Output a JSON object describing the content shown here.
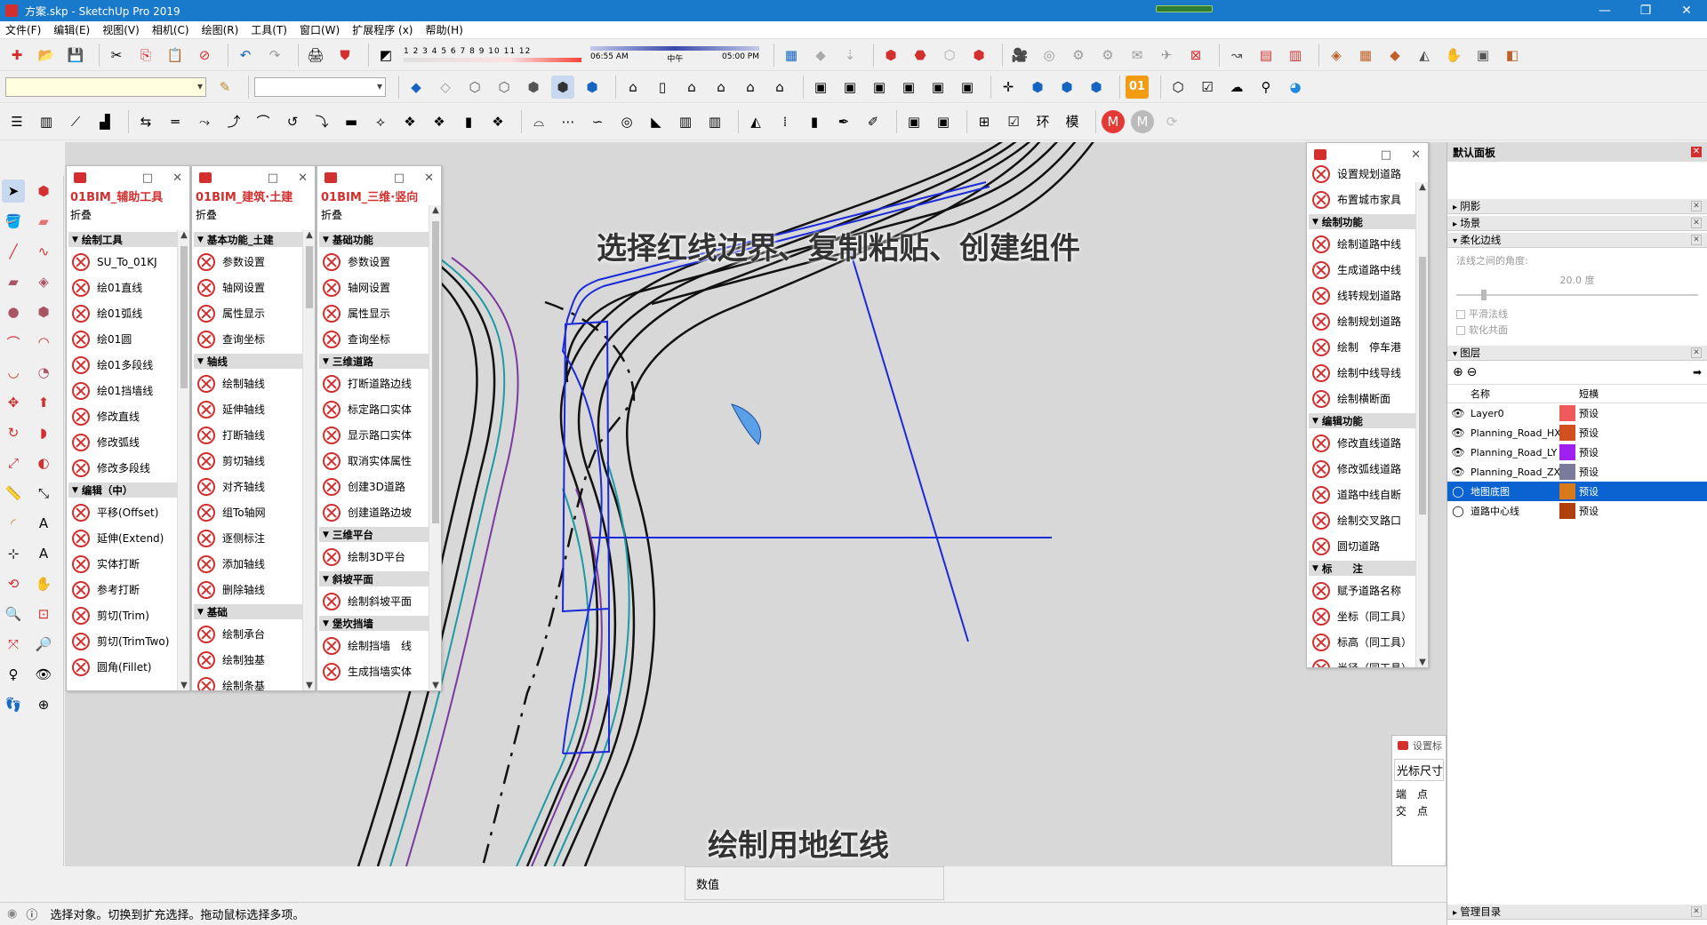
{
  "window": {
    "title": "方案.skp - SketchUp Pro 2019",
    "min": "—",
    "max": "❐",
    "close": "✕"
  },
  "menu": [
    "文件(F)",
    "编辑(E)",
    "视图(V)",
    "相机(C)",
    "绘图(R)",
    "工具(T)",
    "窗口(W)",
    "扩展程序 (x)",
    "帮助(H)"
  ],
  "shadow_scale": {
    "numbers": "1 2 3 4 5 6 7 8 9 10 11 12"
  },
  "time_scale": {
    "start": "06:55 AM",
    "mid": "中午",
    "end": "05:00 PM"
  },
  "toolbar_badge": "01",
  "captions": {
    "top": "选择红线边界、复制粘贴、创建组件",
    "bottom": "绘制用地红线"
  },
  "panel1": {
    "title": "01BIM_辅助工具",
    "fold": "折叠",
    "items": [
      {
        "type": "sec",
        "label": "绘制工具"
      },
      {
        "type": "item",
        "label": "SU_To_01KJ"
      },
      {
        "type": "item",
        "label": "绘01直线"
      },
      {
        "type": "item",
        "label": "绘01弧线"
      },
      {
        "type": "item",
        "label": "绘01圆"
      },
      {
        "type": "item",
        "label": "绘01多段线"
      },
      {
        "type": "item",
        "label": "绘01挡墙线"
      },
      {
        "type": "item",
        "label": "修改直线"
      },
      {
        "type": "item",
        "label": "修改弧线"
      },
      {
        "type": "item",
        "label": "修改多段线"
      },
      {
        "type": "sec",
        "label": "编辑（中）"
      },
      {
        "type": "item",
        "label": "平移(Offset)"
      },
      {
        "type": "item",
        "label": "延伸(Extend)"
      },
      {
        "type": "item",
        "label": "实体打断"
      },
      {
        "type": "item",
        "label": "参考打断"
      },
      {
        "type": "item",
        "label": "剪切(Trim)"
      },
      {
        "type": "item",
        "label": "剪切(TrimTwo)"
      },
      {
        "type": "item",
        "label": "圆角(Fillet)"
      }
    ]
  },
  "panel2": {
    "title": "01BIM_建筑·土建",
    "fold": "折叠",
    "items": [
      {
        "type": "sec",
        "label": "基本功能_土建"
      },
      {
        "type": "item",
        "label": "参数设置"
      },
      {
        "type": "item",
        "label": "轴网设置"
      },
      {
        "type": "item",
        "label": "属性显示"
      },
      {
        "type": "item",
        "label": "查询坐标"
      },
      {
        "type": "sec",
        "label": "轴线"
      },
      {
        "type": "item",
        "label": "绘制轴线"
      },
      {
        "type": "item",
        "label": "延伸轴线"
      },
      {
        "type": "item",
        "label": "打断轴线"
      },
      {
        "type": "item",
        "label": "剪切轴线"
      },
      {
        "type": "item",
        "label": "对齐轴线"
      },
      {
        "type": "item",
        "label": "组To轴网"
      },
      {
        "type": "item",
        "label": "逐侧标注"
      },
      {
        "type": "item",
        "label": "添加轴线"
      },
      {
        "type": "item",
        "label": "删除轴线"
      },
      {
        "type": "sec",
        "label": "基础"
      },
      {
        "type": "item",
        "label": "绘制承台"
      },
      {
        "type": "item",
        "label": "绘制独基"
      },
      {
        "type": "item",
        "label": "绘制条基"
      }
    ]
  },
  "panel3": {
    "title": "01BIM_三维·竖向",
    "fold": "折叠",
    "items": [
      {
        "type": "sec",
        "label": "基础功能"
      },
      {
        "type": "item",
        "label": "参数设置"
      },
      {
        "type": "item",
        "label": "轴网设置"
      },
      {
        "type": "item",
        "label": "属性显示"
      },
      {
        "type": "item",
        "label": "查询坐标"
      },
      {
        "type": "sec",
        "label": "三维道路"
      },
      {
        "type": "item",
        "label": "打断道路边线"
      },
      {
        "type": "item",
        "label": "标定路口实体"
      },
      {
        "type": "item",
        "label": "显示路口实体"
      },
      {
        "type": "item",
        "label": "取消实体属性"
      },
      {
        "type": "item",
        "label": "创建3D道路"
      },
      {
        "type": "item",
        "label": "创建道路边坡"
      },
      {
        "type": "sec",
        "label": "三维平台"
      },
      {
        "type": "item",
        "label": "绘制3D平台"
      },
      {
        "type": "sec",
        "label": "斜坡平面"
      },
      {
        "type": "item",
        "label": "绘制斜坡平面"
      },
      {
        "type": "sec",
        "label": "堡坎挡墙"
      },
      {
        "type": "item",
        "label": "绘制挡墙　线"
      },
      {
        "type": "item",
        "label": "生成挡墙实体"
      }
    ]
  },
  "panel4": {
    "items": [
      {
        "type": "item",
        "label": "设置规划道路"
      },
      {
        "type": "item",
        "label": "布置城市家具"
      },
      {
        "type": "sec",
        "label": "绘制功能"
      },
      {
        "type": "item",
        "label": "绘制道路中线"
      },
      {
        "type": "item",
        "label": "生成道路中线"
      },
      {
        "type": "item",
        "label": "线转规划道路"
      },
      {
        "type": "item",
        "label": "绘制规划道路"
      },
      {
        "type": "item",
        "label": "绘制　停车港"
      },
      {
        "type": "item",
        "label": "绘制中线导线"
      },
      {
        "type": "item",
        "label": "绘制横断面"
      },
      {
        "type": "sec",
        "label": "编辑功能"
      },
      {
        "type": "item",
        "label": "修改直线道路"
      },
      {
        "type": "item",
        "label": "修改弧线道路"
      },
      {
        "type": "item",
        "label": "道路中线自断"
      },
      {
        "type": "item",
        "label": "绘制交叉路口"
      },
      {
        "type": "item",
        "label": "圆切道路"
      },
      {
        "type": "sec",
        "label": "标　　注"
      },
      {
        "type": "item",
        "label": "赋予道路名称"
      },
      {
        "type": "item",
        "label": "坐标（同工具）"
      },
      {
        "type": "item",
        "label": "标高（同工具）"
      },
      {
        "type": "item",
        "label": "半径（同工具）"
      }
    ]
  },
  "tray": {
    "title": "默认面板",
    "sections": {
      "shadows": "阴影",
      "scenes": "场景",
      "soften": "柔化边线",
      "layers": "图层",
      "manage": "管理目录"
    },
    "soften": {
      "angle_label": "法线之间的角度:",
      "angle_value": "20.0 度",
      "smooth_normals": "平滑法线",
      "soften_coplanar": "软化共面"
    },
    "layers": {
      "col_name": "名称",
      "col_style": "短横",
      "rows": [
        {
          "name": "Layer0",
          "style": "预设",
          "color": "#f05a5a",
          "visible": true
        },
        {
          "name": "Planning_Road_HX",
          "style": "预设",
          "color": "#d2501e",
          "visible": true
        },
        {
          "name": "Planning_Road_LY",
          "style": "预设",
          "color": "#a020f0",
          "visible": true
        },
        {
          "name": "Planning_Road_ZX",
          "style": "预设",
          "color": "#7a7a9a",
          "visible": true
        },
        {
          "name": "地图底图",
          "style": "预设",
          "color": "#d87a1a",
          "visible": false,
          "selected": true
        },
        {
          "name": "道路中心线",
          "style": "预设",
          "color": "#b04010",
          "visible": false
        }
      ]
    }
  },
  "small_dialog": {
    "title": "设置标",
    "line1": "光标尺寸",
    "line2": "端　点",
    "line3": "交　点"
  },
  "measurements": {
    "label": "数值",
    "value": ""
  },
  "status": {
    "text": "选择对象。切换到扩充选择。拖动鼠标选择多项。"
  },
  "colors": {
    "title_bar": "#1979ca",
    "plugin_red": "#d32f2f",
    "selection_blue": "#0a63d1",
    "viewport": "#d8d8d8"
  }
}
